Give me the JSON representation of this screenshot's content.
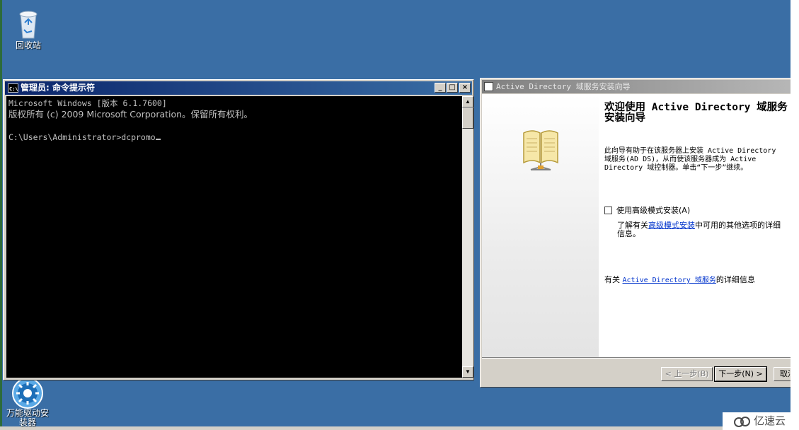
{
  "desktop": {
    "background_color": "#3a6ea5",
    "icons": [
      {
        "label": "回收站",
        "icon": "recycle-bin-icon"
      },
      {
        "label": "万能驱动安\n装器",
        "icon": "driver-installer-icon"
      }
    ]
  },
  "cmd_window": {
    "title": "管理员: 命令提示符",
    "buttons": {
      "minimize": "_",
      "maximize": "□",
      "close": "×"
    },
    "console_lines": [
      "Microsoft Windows [版本 6.1.7600]",
      "版权所有 (c) 2009 Microsoft Corporation。保留所有权利。",
      "",
      "C:\\Users\\Administrator>dcpromo"
    ]
  },
  "wizard": {
    "title": "Active Directory 域服务安装向导",
    "heading": "欢迎使用 Active Directory 域服务\n安装向导",
    "description": "此向导有助于在该服务器上安装 Active Directory\n域服务(AD DS)，从而使该服务器成为 Active\nDirectory 域控制器。单击“下一步”继续。",
    "advanced_checkbox_label": "使用高级模式安装(A)",
    "advanced_checked": false,
    "learn_prefix": "了解有关",
    "learn_link": "高级模式安装",
    "learn_suffix": "中可用的其他选项的详细\n信息。",
    "more_info_prefix": "有关 ",
    "more_info_link": "Active Directory 域服务",
    "more_info_suffix": "的详细信息",
    "buttons": {
      "back": "< 上一步(B)",
      "next": "下一步(N) >",
      "cancel": "取消"
    }
  },
  "watermark": {
    "text": "亿速云"
  }
}
